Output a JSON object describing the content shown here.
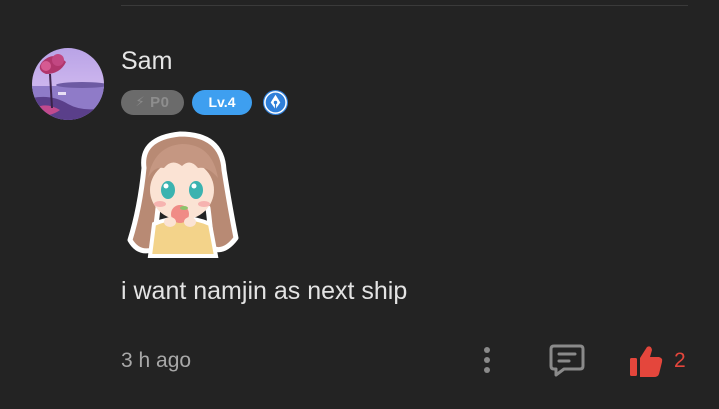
{
  "comment": {
    "username": "Sam",
    "badges": {
      "points_label": "P0",
      "points_icon": "bolt-icon",
      "level_label": "Lv.4",
      "role_icon": "pen-nib-badge-icon"
    },
    "sticker": "anime-girl-sticker",
    "text": "i want namjin as next ship",
    "timestamp": "3 h ago",
    "actions": {
      "more_icon": "more-vertical-icon",
      "reply_icon": "comment-icon",
      "like_icon": "thumbs-up-icon",
      "like_count": "2"
    }
  },
  "colors": {
    "background": "#232323",
    "level_badge": "#3e9ff0",
    "points_badge": "#6b6b6b",
    "like": "#e4463c"
  }
}
